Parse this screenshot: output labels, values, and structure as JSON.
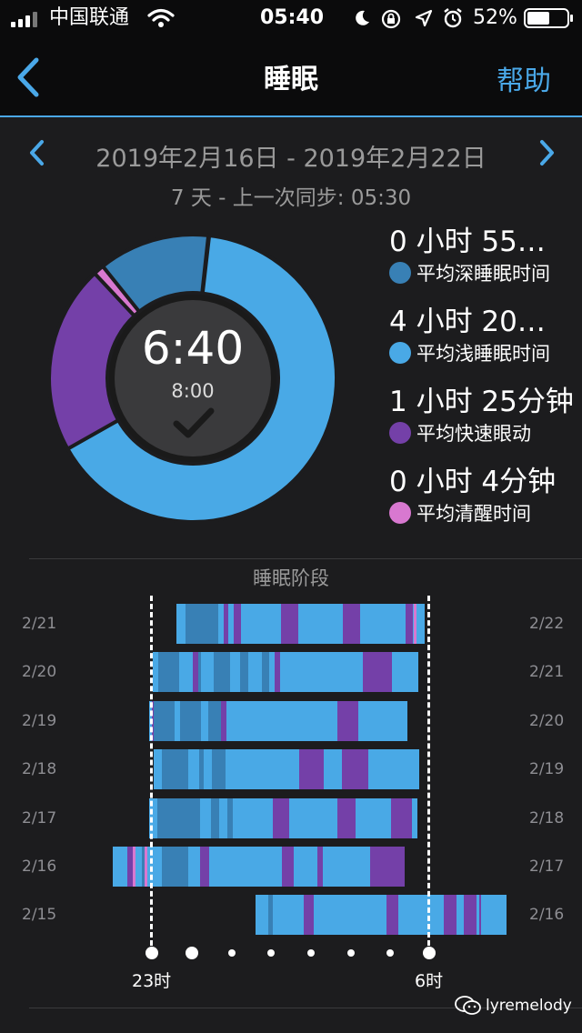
{
  "status_bar": {
    "carrier": "中国联通",
    "time": "05:40",
    "battery": "52%",
    "icons": [
      "signal-icon",
      "wifi-icon",
      "moon-icon",
      "rotation-lock-icon",
      "location-icon",
      "alarm-icon",
      "battery-icon"
    ]
  },
  "nav": {
    "title": "睡眠",
    "help": "帮助"
  },
  "header": {
    "date_range": "2019年2月16日 - 2019年2月22日",
    "sync_text": "7 天 - 上一次同步: 05:30"
  },
  "colors": {
    "deep": "#3880b5",
    "light": "#49a9e6",
    "rem": "#7440a8",
    "awake": "#d878d0",
    "accent": "#4aa8e8"
  },
  "donut": {
    "center_value": "6:40",
    "goal": "8:00",
    "segments": [
      {
        "stage": "light",
        "fraction": 0.65
      },
      {
        "stage": "rem",
        "fraction": 0.212
      },
      {
        "stage": "awake",
        "fraction": 0.012
      },
      {
        "stage": "deep",
        "fraction": 0.125
      }
    ]
  },
  "legend": [
    {
      "value": "0 小时 55…",
      "label": "平均深睡眠时间",
      "stage": "deep"
    },
    {
      "value": "4 小时 20…",
      "label": "平均浅睡眠时间",
      "stage": "light"
    },
    {
      "value": "1 小时 25分钟",
      "label": "平均快速眼动",
      "stage": "rem"
    },
    {
      "value": "0 小时 4分钟",
      "label": "平均清醒时间",
      "stage": "awake"
    }
  ],
  "stages": {
    "title": "睡眠阶段",
    "rows": [
      {
        "left": "2/21",
        "right": "2/22",
        "start": 0.084,
        "end": 0.985,
        "segs": [
          [
            "deep",
            0.04,
            0.17
          ],
          [
            "rem",
            0.19,
            0.21
          ],
          [
            "rem",
            0.23,
            0.26
          ],
          [
            "rem",
            0.42,
            0.49
          ],
          [
            "rem",
            0.67,
            0.74
          ],
          [
            "rem",
            0.92,
            0.95
          ],
          [
            "awake",
            0.955,
            0.965
          ]
        ]
      },
      {
        "left": "2/20",
        "right": "2/21",
        "start": 0.0,
        "end": 0.96,
        "segs": [
          [
            "deep",
            0.02,
            0.1
          ],
          [
            "rem",
            0.15,
            0.17
          ],
          [
            "deep",
            0.17,
            0.18
          ],
          [
            "deep",
            0.23,
            0.29
          ],
          [
            "deep",
            0.33,
            0.36
          ],
          [
            "deep",
            0.41,
            0.44
          ],
          [
            "rem",
            0.46,
            0.48
          ],
          [
            "rem",
            0.79,
            0.9
          ]
        ]
      },
      {
        "left": "2/19",
        "right": "2/20",
        "start": -0.014,
        "end": 0.92,
        "segs": [
          [
            "rem",
            0.01,
            0.02
          ],
          [
            "deep",
            0.02,
            0.1
          ],
          [
            "deep",
            0.12,
            0.2
          ],
          [
            "deep",
            0.23,
            0.28
          ],
          [
            "rem",
            0.28,
            0.3
          ],
          [
            "rem",
            0.73,
            0.81
          ]
        ]
      },
      {
        "left": "2/18",
        "right": "2/19",
        "start": 0.003,
        "end": 0.963,
        "segs": [
          [
            "deep",
            0.03,
            0.13
          ],
          [
            "deep",
            0.17,
            0.19
          ],
          [
            "deep",
            0.22,
            0.27
          ],
          [
            "rem",
            0.55,
            0.64
          ],
          [
            "rem",
            0.71,
            0.81
          ]
        ]
      },
      {
        "left": "2/17",
        "right": "2/18",
        "start": -0.013,
        "end": 0.958,
        "segs": [
          [
            "deep",
            0.03,
            0.19
          ],
          [
            "deep",
            0.23,
            0.26
          ],
          [
            "deep",
            0.29,
            0.31
          ],
          [
            "rem",
            0.46,
            0.52
          ],
          [
            "rem",
            0.7,
            0.77
          ],
          [
            "rem",
            0.9,
            0.98
          ]
        ]
      },
      {
        "left": "2/16",
        "right": "2/17",
        "start": -0.146,
        "end": 0.912,
        "segs": [
          [
            "rem",
            0.05,
            0.07
          ],
          [
            "awake",
            0.07,
            0.08
          ],
          [
            "deep",
            0.1,
            0.11
          ],
          [
            "awake",
            0.11,
            0.12
          ],
          [
            "deep",
            0.17,
            0.26
          ],
          [
            "rem",
            0.3,
            0.33
          ],
          [
            "rem",
            0.58,
            0.62
          ],
          [
            "rem",
            0.88,
            1.0
          ],
          [
            "rem",
            0.7,
            0.72
          ]
        ]
      },
      {
        "left": "2/15",
        "right": "2/16",
        "start": 0.372,
        "end": 1.28,
        "segs": [
          [
            "deep",
            0.05,
            0.07
          ],
          [
            "rem",
            0.19,
            0.23
          ],
          [
            "rem",
            0.52,
            0.57
          ],
          [
            "rem",
            0.75,
            0.8
          ],
          [
            "rem",
            0.83,
            0.88
          ],
          [
            "rem",
            0.89,
            0.9
          ]
        ]
      }
    ],
    "x_start": "23时",
    "x_end": "6时"
  },
  "watermark": "lyremelody"
}
